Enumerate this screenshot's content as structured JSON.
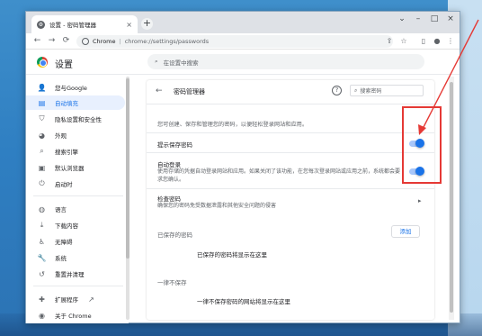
{
  "window": {
    "tab_title": "设置 - 密码管理器",
    "tab_close": "×",
    "new_tab": "+",
    "controls": [
      "⌄",
      "–",
      "□",
      "×"
    ]
  },
  "toolbar": {
    "back": "←",
    "forward": "→",
    "reload": "C",
    "site_name": "Chrome",
    "separator": "|",
    "url": "chrome://settings/passwords",
    "icons": [
      "share-icon",
      "star-icon",
      "sidepanel-icon",
      "profile-icon",
      "menu-icon"
    ]
  },
  "settings": {
    "title": "设置",
    "search_placeholder": "在设置中搜索"
  },
  "sidebar": {
    "items": [
      {
        "label": "您与Google",
        "icon": "person-icon",
        "active": false
      },
      {
        "label": "自动填充",
        "icon": "autofill-icon",
        "active": true
      },
      {
        "label": "隐私设置和安全性",
        "icon": "shield-icon",
        "active": false
      },
      {
        "label": "外观",
        "icon": "palette-icon",
        "active": false
      },
      {
        "label": "搜索引擎",
        "icon": "search-icon",
        "active": false
      },
      {
        "label": "默认浏览器",
        "icon": "browser-icon",
        "active": false
      },
      {
        "label": "启动时",
        "icon": "power-icon",
        "active": false
      },
      {
        "label": "语言",
        "icon": "globe-icon",
        "active": false
      },
      {
        "label": "下载内容",
        "icon": "download-icon",
        "active": false
      },
      {
        "label": "无障碍",
        "icon": "accessibility-icon",
        "active": false
      },
      {
        "label": "系统",
        "icon": "wrench-icon",
        "active": false
      },
      {
        "label": "重置并清理",
        "icon": "reset-icon",
        "active": false
      },
      {
        "label": "扩展程序",
        "icon": "puzzle-icon",
        "active": false
      },
      {
        "label": "关于 Chrome",
        "icon": "chrome-icon",
        "active": false
      }
    ]
  },
  "password_manager": {
    "title": "密码管理器",
    "search_placeholder": "搜索密码",
    "description": "您可创建、保存和管理您的密码，以便轻松登录网站和应用。",
    "offer_to_save": {
      "label": "提示保存密码",
      "enabled": true
    },
    "auto_signin": {
      "label": "自动登录",
      "description": "使用存储的凭据自动登录网站和应用。如果关闭了该功能，在您每次登录网站或应用之前，系统都会要求您确认。",
      "enabled": true
    },
    "check_passwords": {
      "label": "检查密码",
      "description": "确保您的密码免受数据泄露和其他安全问题的侵害"
    },
    "saved": {
      "title": "已保存的密码",
      "add_label": "添加",
      "empty": "已保存的密码将显示在这里"
    },
    "never_saved": {
      "title": "一律不保存",
      "empty": "一律不保存密码的网站将显示在这里"
    }
  },
  "annotation": {
    "color": "#e53935"
  }
}
